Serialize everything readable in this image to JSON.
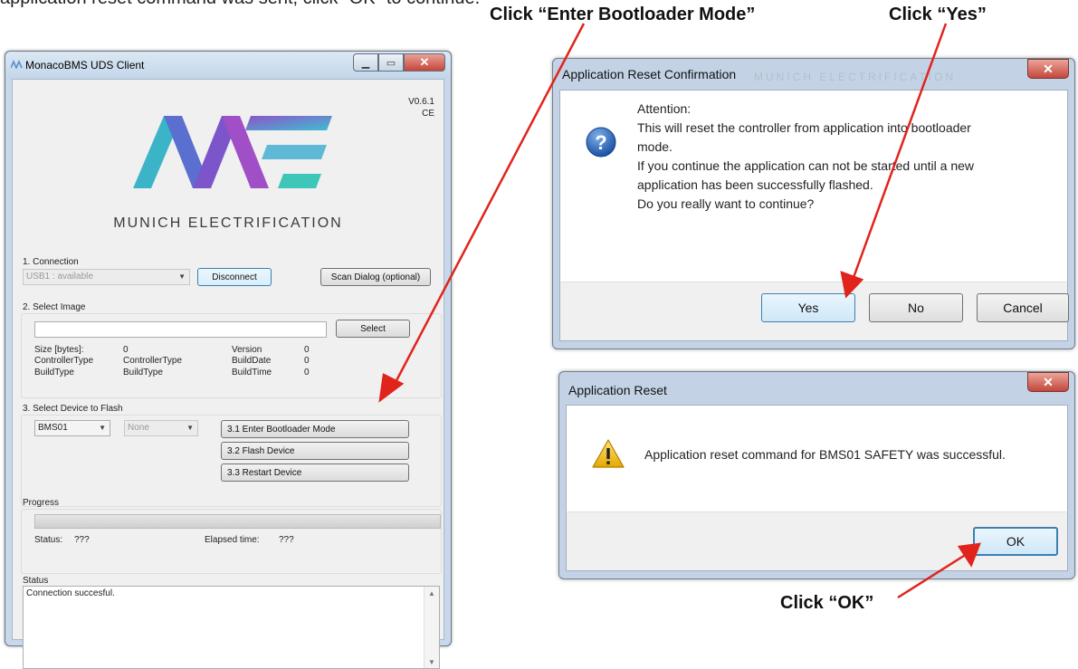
{
  "annotations": {
    "top_caption": "application reset command was sent, click “OK” to continue.",
    "enter_bootloader": "Click “Enter Bootloader Mode”",
    "yes": "Click “Yes”",
    "ok": "Click “OK”",
    "arrow_color": "#e0241c"
  },
  "main_window": {
    "title": "MonacoBMS UDS Client",
    "version": "V0.6.1",
    "edition": "CE",
    "brand": "MUNICH ELECTRIFICATION",
    "connection": {
      "heading": "1. Connection",
      "port_value": "USB1 : available",
      "disconnect_label": "Disconnect",
      "scan_label": "Scan Dialog (optional)"
    },
    "image": {
      "heading": "2. Select Image",
      "path_value": "",
      "select_label": "Select",
      "size_label": "Size [bytes]:",
      "size_value": "0",
      "controller_label": "ControllerType",
      "controller_value": "ControllerType",
      "buildtype_label": "BuildType",
      "buildtype_value": "BuildType",
      "version_label": "Version",
      "version_value": "0",
      "builddate_label": "BuildDate",
      "builddate_value": "0",
      "buildtime_label": "BuildTime",
      "buildtime_value": "0"
    },
    "device": {
      "heading": "3. Select Device to Flash",
      "device_value": "BMS01",
      "mode_value": "None",
      "enter_bootloader": "3.1 Enter Bootloader Mode",
      "flash_device": "3.2 Flash Device",
      "restart_device": "3.3 Restart Device"
    },
    "progress": {
      "heading": "Progress",
      "status_label": "Status:",
      "status_value": "???",
      "elapsed_label": "Elapsed time:",
      "elapsed_value": "???"
    },
    "status": {
      "heading": "Status",
      "text": "Connection succesful."
    }
  },
  "confirm_dialog": {
    "title": "Application Reset Confirmation",
    "watermark": "MUNICH ELECTRIFICATION",
    "lines": [
      "Attention:",
      "This will reset the controller from application into bootloader",
      "mode.",
      "If you continue the application can not be started until a new",
      "application has been successfully flashed.",
      " Do you really want to continue?"
    ],
    "yes_label": "Yes",
    "no_label": "No",
    "cancel_label": "Cancel"
  },
  "result_dialog": {
    "title": "Application Reset",
    "message": "Application reset command for BMS01 SAFETY was successful.",
    "ok_label": "OK"
  }
}
